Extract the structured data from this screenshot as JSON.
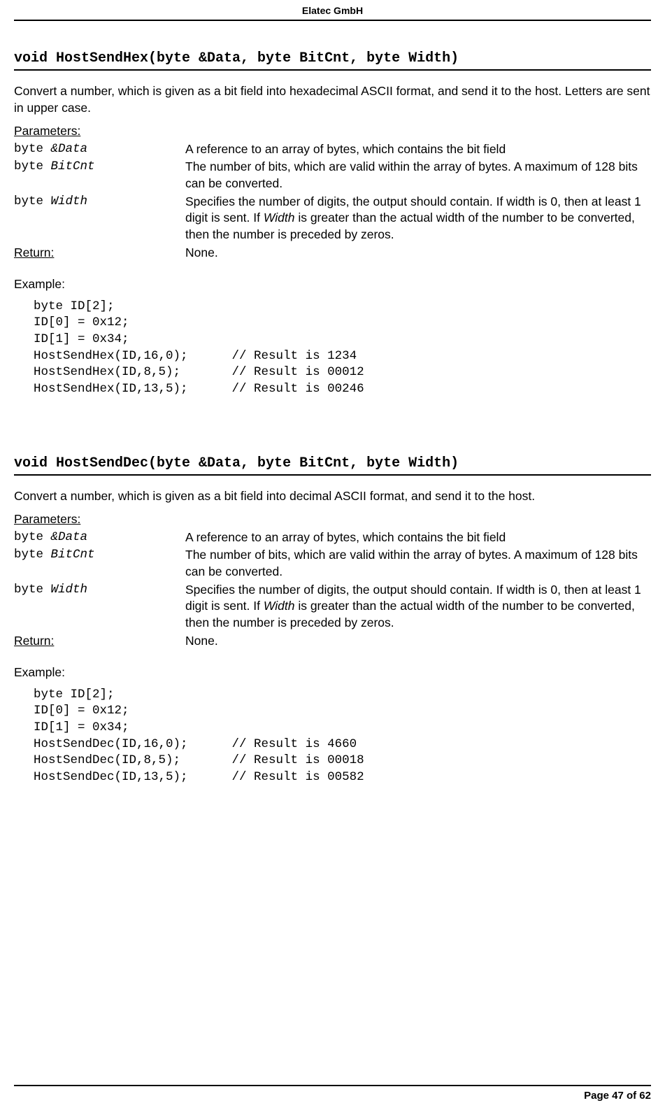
{
  "header": {
    "company": "Elatec GmbH"
  },
  "footer": {
    "page_text": "Page 47 of 62"
  },
  "sec1": {
    "title": "void HostSendHex(byte &Data, byte BitCnt, byte Width)",
    "desc": "Convert a number, which is given as a bit field into hexadecimal ASCII format, and send it to the host. Letters are sent in upper case.",
    "params_label": "Parameters:",
    "p1": {
      "kw": "byte ",
      "id": "&Data",
      "desc": "A reference to an array of bytes, which contains the bit field"
    },
    "p2": {
      "kw": "byte ",
      "id": "BitCnt",
      "desc": "The number of bits, which are valid within the array of bytes. A maximum of 128 bits can be converted."
    },
    "p3": {
      "kw": "byte ",
      "id": "Width",
      "desc_a": "Specifies the number of digits, the output should contain. If width is 0, then at least 1 digit is sent. If ",
      "desc_i": "Width",
      "desc_b": " is greater than the actual width of the number to be converted, then the number is preceded by zeros."
    },
    "return_label": "Return:",
    "return_value": "None.",
    "example_label": "Example:",
    "code": "byte ID[2];\nID[0] = 0x12;\nID[1] = 0x34;\nHostSendHex(ID,16,0);      // Result is 1234\nHostSendHex(ID,8,5);       // Result is 00012\nHostSendHex(ID,13,5);      // Result is 00246"
  },
  "sec2": {
    "title": "void HostSendDec(byte &Data, byte BitCnt, byte Width)",
    "desc": "Convert a number, which is given as a bit field into decimal ASCII format, and send it to the host.",
    "params_label": "Parameters:",
    "p1": {
      "kw": "byte ",
      "id": "&Data",
      "desc": "A reference to an array of bytes, which contains the bit field"
    },
    "p2": {
      "kw": "byte ",
      "id": "BitCnt",
      "desc": "The number of bits, which are valid within the array of bytes. A maximum of 128 bits can be converted."
    },
    "p3": {
      "kw": "byte ",
      "id": "Width",
      "desc_a": "Specifies the number of digits, the output should contain. If width is 0, then at least 1 digit is sent. If ",
      "desc_i": "Width",
      "desc_b": " is greater than the actual width of the number to be converted, then the number is preceded by zeros."
    },
    "return_label": "Return:",
    "return_value": "None.",
    "example_label": "Example:",
    "code": "byte ID[2];\nID[0] = 0x12;\nID[1] = 0x34;\nHostSendDec(ID,16,0);      // Result is 4660\nHostSendDec(ID,8,5);       // Result is 00018\nHostSendDec(ID,13,5);      // Result is 00582"
  }
}
